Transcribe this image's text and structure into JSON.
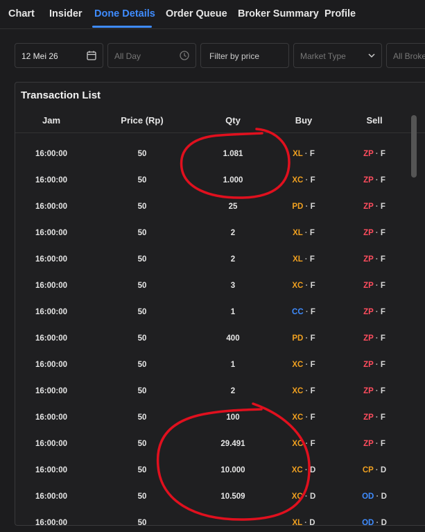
{
  "tabs": [
    {
      "label": "Chart"
    },
    {
      "label": "Insider"
    },
    {
      "label": "Done Details"
    },
    {
      "label": "Order Queue"
    },
    {
      "label": "Broker Summary"
    },
    {
      "label": "Profile"
    }
  ],
  "active_tab_index": 2,
  "filters": {
    "date": "12 Mei 26",
    "time_placeholder": "All Day",
    "price_placeholder": "Filter by price",
    "market_type_placeholder": "Market Type",
    "broker_placeholder": "All Broke"
  },
  "panel": {
    "title": "Transaction List",
    "columns": [
      "Jam",
      "Price (Rp)",
      "Qty",
      "Buy",
      "Sell"
    ]
  },
  "colors": {
    "accent": "#3f8cff",
    "broker_orange": "#f0a020",
    "broker_red": "#ff4d5e",
    "broker_blue": "#3f8cff",
    "annotation_red": "#e0101e"
  },
  "rows": [
    {
      "time": "16:00:00",
      "price": "50",
      "qty": "1.081",
      "buy": "XL",
      "buy_color": "#f0a020",
      "buy_type": "F",
      "sell": "ZP",
      "sell_color": "#ff4d5e",
      "sell_type": "F"
    },
    {
      "time": "16:00:00",
      "price": "50",
      "qty": "1.000",
      "buy": "XC",
      "buy_color": "#f0a020",
      "buy_type": "F",
      "sell": "ZP",
      "sell_color": "#ff4d5e",
      "sell_type": "F"
    },
    {
      "time": "16:00:00",
      "price": "50",
      "qty": "25",
      "buy": "PD",
      "buy_color": "#f0a020",
      "buy_type": "F",
      "sell": "ZP",
      "sell_color": "#ff4d5e",
      "sell_type": "F"
    },
    {
      "time": "16:00:00",
      "price": "50",
      "qty": "2",
      "buy": "XL",
      "buy_color": "#f0a020",
      "buy_type": "F",
      "sell": "ZP",
      "sell_color": "#ff4d5e",
      "sell_type": "F"
    },
    {
      "time": "16:00:00",
      "price": "50",
      "qty": "2",
      "buy": "XL",
      "buy_color": "#f0a020",
      "buy_type": "F",
      "sell": "ZP",
      "sell_color": "#ff4d5e",
      "sell_type": "F"
    },
    {
      "time": "16:00:00",
      "price": "50",
      "qty": "3",
      "buy": "XC",
      "buy_color": "#f0a020",
      "buy_type": "F",
      "sell": "ZP",
      "sell_color": "#ff4d5e",
      "sell_type": "F"
    },
    {
      "time": "16:00:00",
      "price": "50",
      "qty": "1",
      "buy": "CC",
      "buy_color": "#3f8cff",
      "buy_type": "F",
      "sell": "ZP",
      "sell_color": "#ff4d5e",
      "sell_type": "F"
    },
    {
      "time": "16:00:00",
      "price": "50",
      "qty": "400",
      "buy": "PD",
      "buy_color": "#f0a020",
      "buy_type": "F",
      "sell": "ZP",
      "sell_color": "#ff4d5e",
      "sell_type": "F"
    },
    {
      "time": "16:00:00",
      "price": "50",
      "qty": "1",
      "buy": "XC",
      "buy_color": "#f0a020",
      "buy_type": "F",
      "sell": "ZP",
      "sell_color": "#ff4d5e",
      "sell_type": "F"
    },
    {
      "time": "16:00:00",
      "price": "50",
      "qty": "2",
      "buy": "XC",
      "buy_color": "#f0a020",
      "buy_type": "F",
      "sell": "ZP",
      "sell_color": "#ff4d5e",
      "sell_type": "F"
    },
    {
      "time": "16:00:00",
      "price": "50",
      "qty": "100",
      "buy": "XC",
      "buy_color": "#f0a020",
      "buy_type": "F",
      "sell": "ZP",
      "sell_color": "#ff4d5e",
      "sell_type": "F"
    },
    {
      "time": "16:00:00",
      "price": "50",
      "qty": "29.491",
      "buy": "XC",
      "buy_color": "#f0a020",
      "buy_type": "F",
      "sell": "ZP",
      "sell_color": "#ff4d5e",
      "sell_type": "F"
    },
    {
      "time": "16:00:00",
      "price": "50",
      "qty": "10.000",
      "buy": "XC",
      "buy_color": "#f0a020",
      "buy_type": "D",
      "sell": "CP",
      "sell_color": "#f0a020",
      "sell_type": "D"
    },
    {
      "time": "16:00:00",
      "price": "50",
      "qty": "10.509",
      "buy": "XC",
      "buy_color": "#f0a020",
      "buy_type": "D",
      "sell": "OD",
      "sell_color": "#3f8cff",
      "sell_type": "D"
    },
    {
      "time": "16:00:00",
      "price": "50",
      "qty": "",
      "buy": "XL",
      "buy_color": "#f0a020",
      "buy_type": "D",
      "sell": "OD",
      "sell_color": "#3f8cff",
      "sell_type": "D"
    }
  ]
}
